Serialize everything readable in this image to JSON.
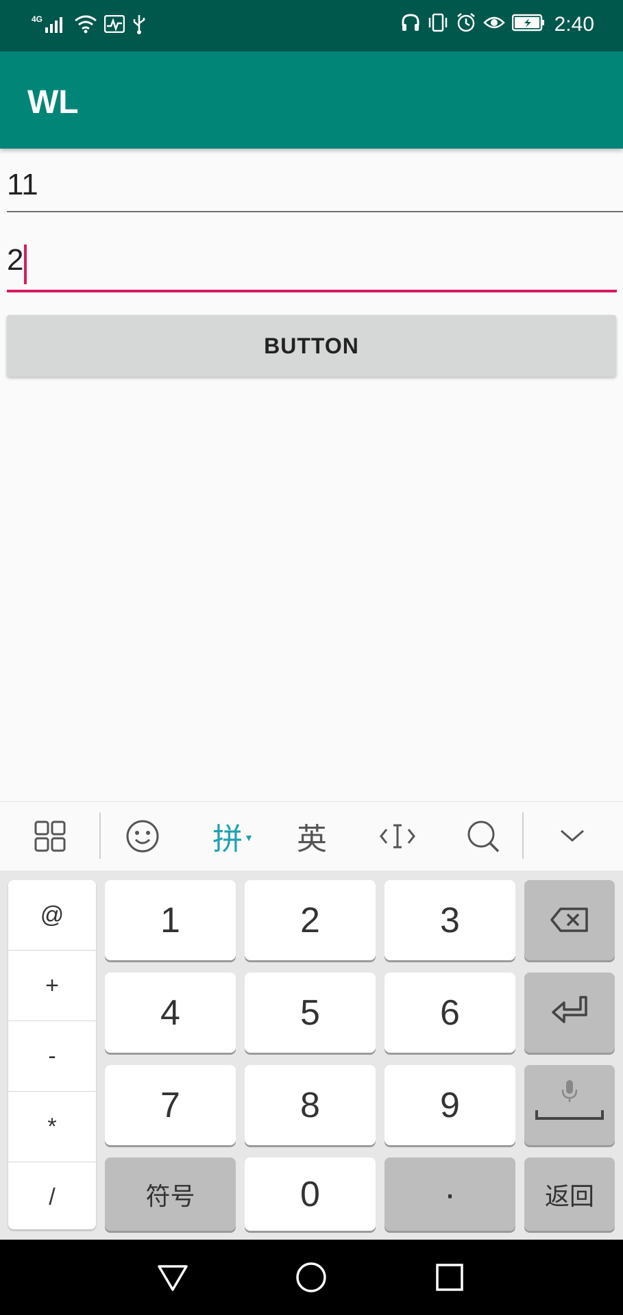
{
  "status_bar": {
    "network_label": "4G",
    "time": "2:40",
    "icons": [
      "signal-icon",
      "wifi-icon",
      "activity-icon",
      "usb-icon",
      "headphones-icon",
      "vibrate-icon",
      "alarm-icon",
      "eye-icon",
      "battery-charging-icon"
    ]
  },
  "app_bar": {
    "title": "WL"
  },
  "form": {
    "field1_value": "11",
    "field2_value": "2",
    "button_label": "BUTTON"
  },
  "keyboard": {
    "toolbar": {
      "pinyin_label": "拼",
      "english_label": "英",
      "icons": [
        "grid-icon",
        "emoji-icon",
        "cursor-move-icon",
        "search-icon",
        "collapse-keyboard-icon"
      ]
    },
    "left_column": [
      "@",
      "+",
      "-",
      "*",
      "/"
    ],
    "digits": [
      "1",
      "2",
      "3",
      "4",
      "5",
      "6",
      "7",
      "8",
      "9",
      "0"
    ],
    "symbols_label": "符号",
    "dot_label": "·",
    "return_label": "返回"
  },
  "colors": {
    "status_bar": "#00574b",
    "app_bar": "#008577",
    "accent": "#d81b60",
    "ime_accent": "#1fa2b1"
  }
}
